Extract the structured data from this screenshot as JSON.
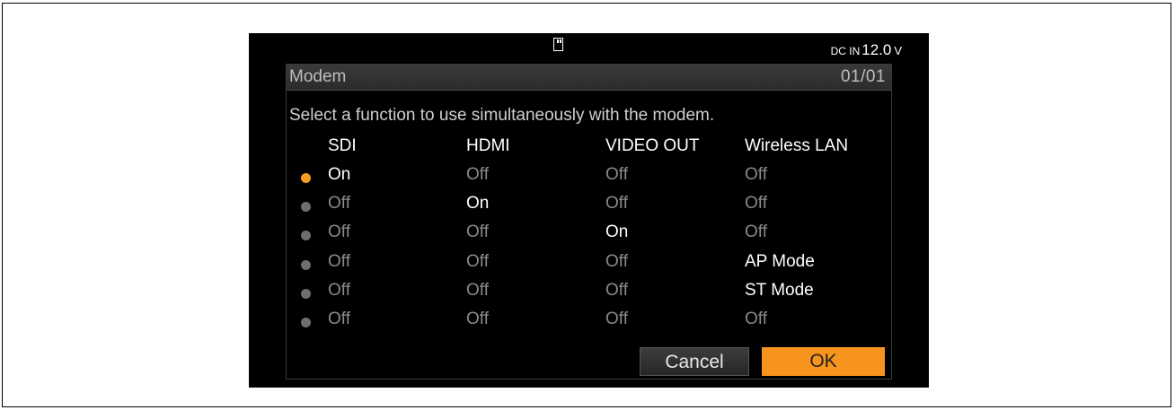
{
  "status": {
    "media_icon": "media-card-icon",
    "dcin_label": "DC IN",
    "dcin_value": "12.0",
    "dcin_unit": "V"
  },
  "dialog": {
    "title": "Modem",
    "page": "01/01",
    "instruction": "Select a function to use simultaneously with the modem.",
    "columns": [
      "SDI",
      "HDMI",
      "VIDEO OUT",
      "Wireless LAN"
    ],
    "rows": [
      {
        "selected": true,
        "cells": [
          "On",
          "Off",
          "Off",
          "Off"
        ]
      },
      {
        "selected": false,
        "cells": [
          "Off",
          "On",
          "Off",
          "Off"
        ]
      },
      {
        "selected": false,
        "cells": [
          "Off",
          "Off",
          "On",
          "Off"
        ]
      },
      {
        "selected": false,
        "cells": [
          "Off",
          "Off",
          "Off",
          "AP Mode"
        ]
      },
      {
        "selected": false,
        "cells": [
          "Off",
          "Off",
          "Off",
          "ST Mode"
        ]
      },
      {
        "selected": false,
        "cells": [
          "Off",
          "Off",
          "Off",
          "Off"
        ]
      }
    ],
    "cancel_label": "Cancel",
    "ok_label": "OK"
  },
  "colors": {
    "accent": "#f7941d",
    "radio_selected": "#f59a20",
    "radio_unselected": "#6e6e6e",
    "text_on": "#ffffff",
    "text_off": "#8a8a8a"
  }
}
